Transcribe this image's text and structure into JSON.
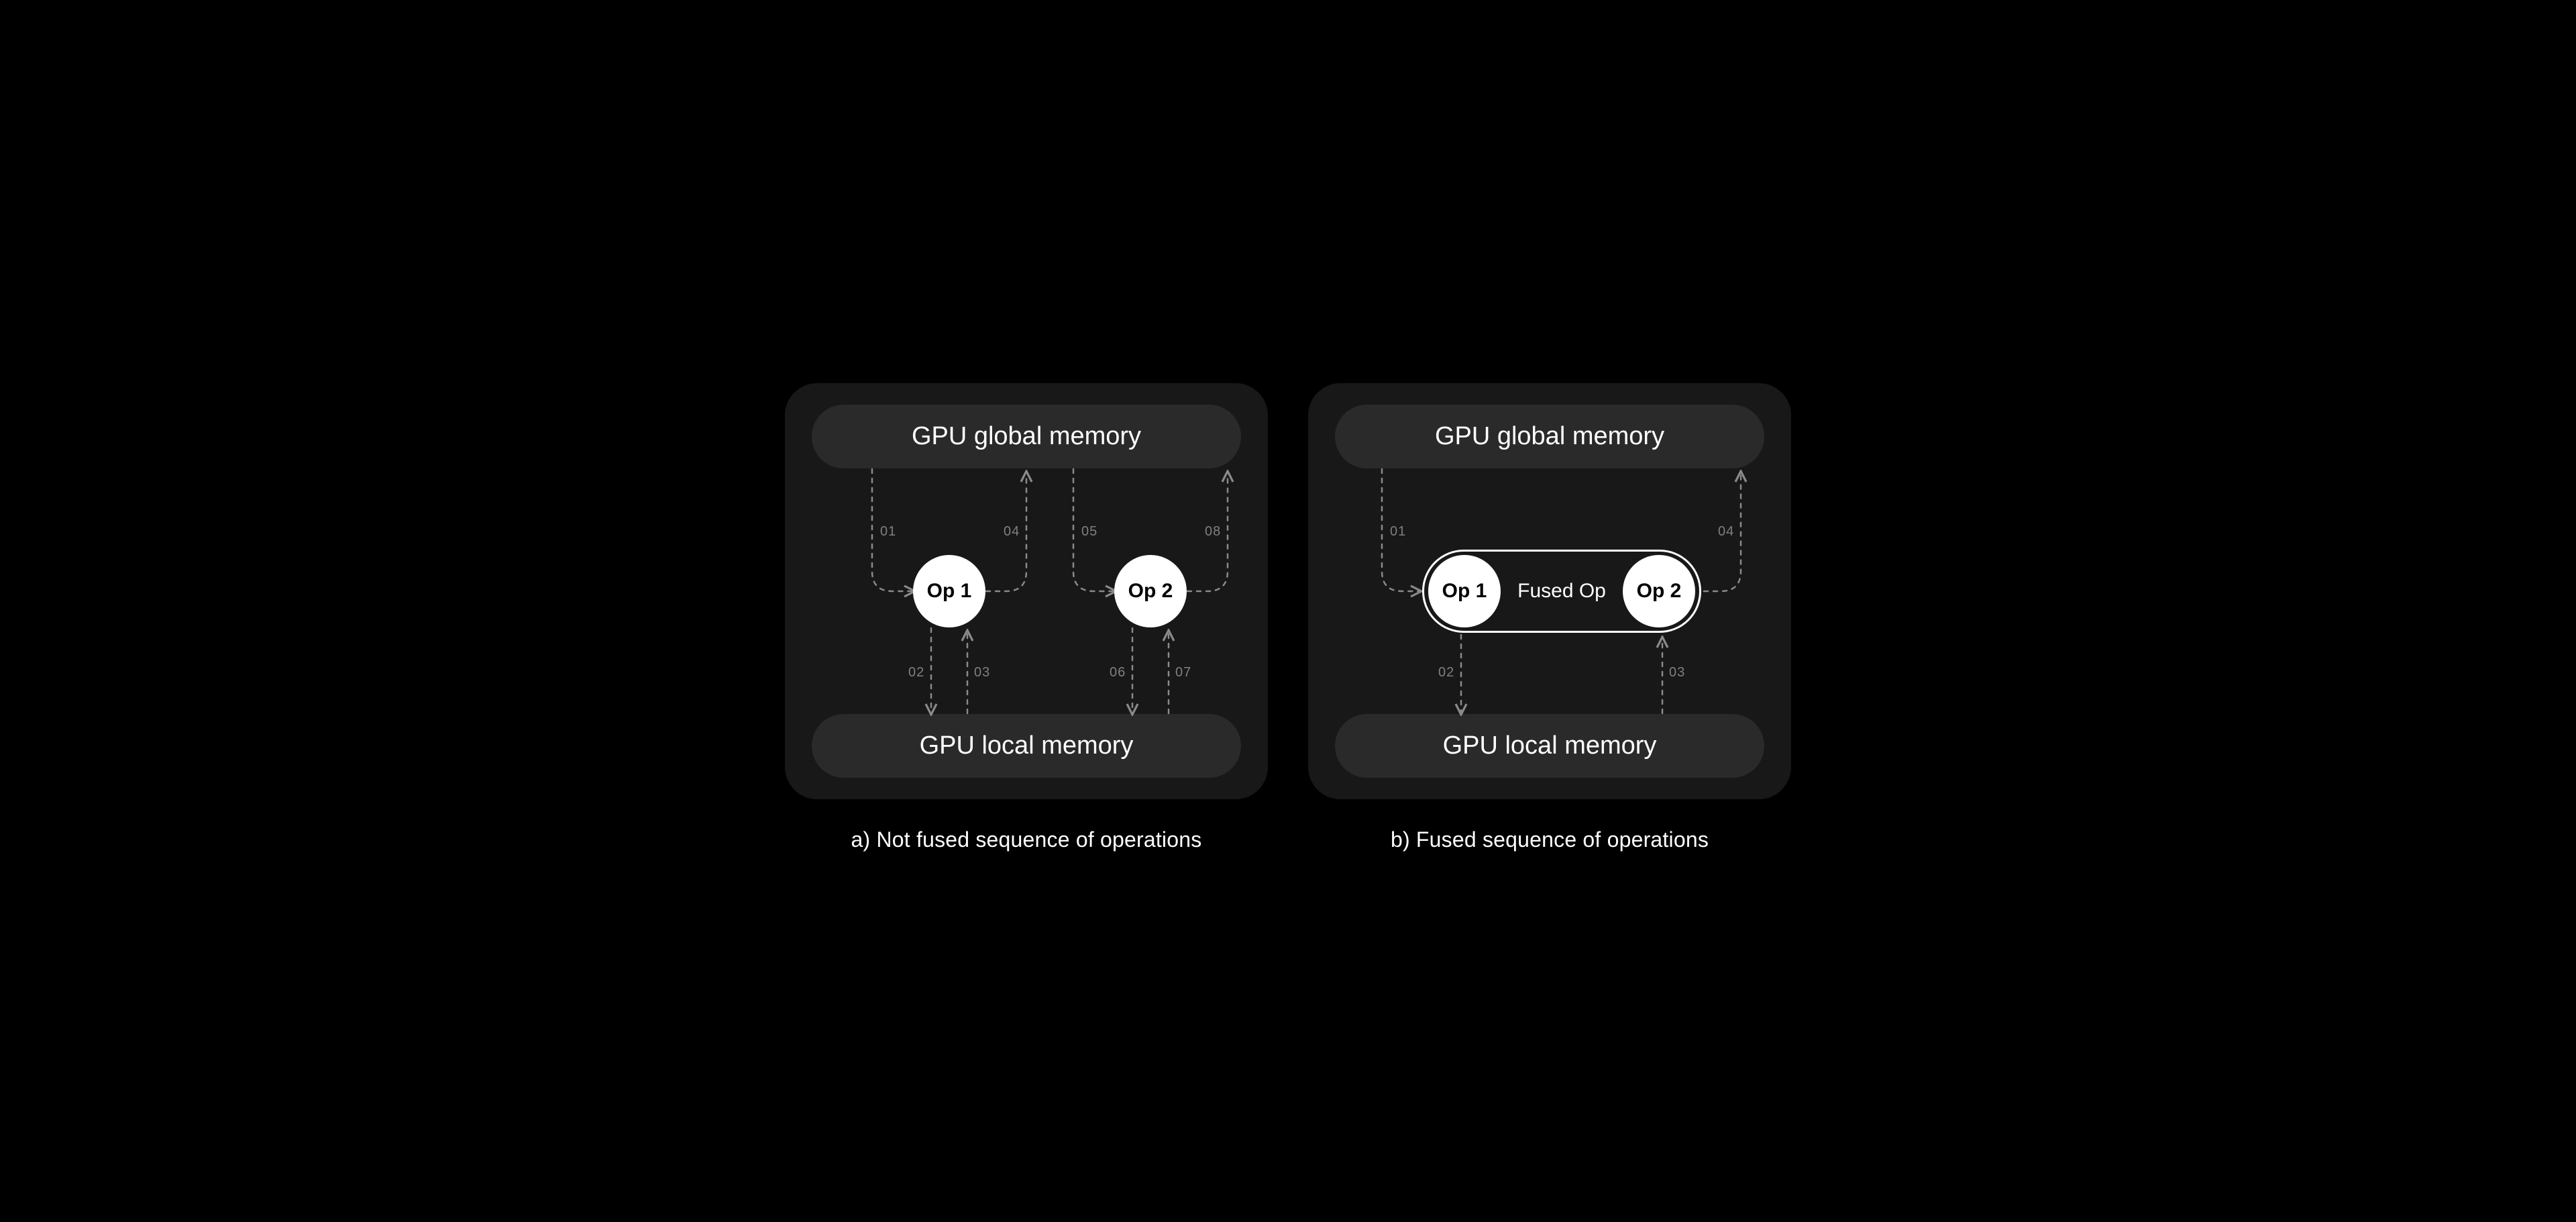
{
  "diagram": {
    "left": {
      "caption": "a) Not fused sequence of operations",
      "global_memory": "GPU global memory",
      "local_memory": "GPU local memory",
      "op1": "Op 1",
      "op2": "Op 2",
      "steps": {
        "s1": "01",
        "s2": "02",
        "s3": "03",
        "s4": "04",
        "s5": "05",
        "s6": "06",
        "s7": "07",
        "s8": "08"
      }
    },
    "right": {
      "caption": "b) Fused sequence of operations",
      "global_memory": "GPU global memory",
      "local_memory": "GPU local memory",
      "op1": "Op 1",
      "op2": "Op 2",
      "fused_label": "Fused Op",
      "steps": {
        "s1": "01",
        "s2": "02",
        "s3": "03",
        "s4": "04"
      }
    }
  }
}
